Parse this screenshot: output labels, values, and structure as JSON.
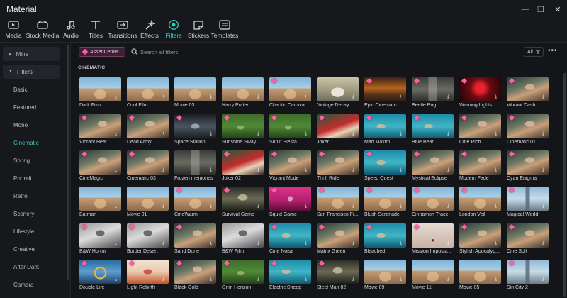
{
  "window": {
    "title": "Material",
    "minimize_icon": "—",
    "restore_icon": "❐",
    "close_icon": "✕"
  },
  "toolbar": {
    "items": [
      {
        "label": "Media",
        "icon": "media-icon"
      },
      {
        "label": "Stock Media",
        "icon": "stock-media-icon"
      },
      {
        "label": "Audio",
        "icon": "audio-icon"
      },
      {
        "label": "Titles",
        "icon": "titles-icon"
      },
      {
        "label": "Transitions",
        "icon": "transitions-icon"
      },
      {
        "label": "Effects",
        "icon": "effects-icon"
      },
      {
        "label": "Filters",
        "icon": "filters-icon",
        "active": true
      },
      {
        "label": "Stickers",
        "icon": "stickers-icon"
      },
      {
        "label": "Templates",
        "icon": "templates-icon"
      }
    ]
  },
  "sidebar": {
    "mine": "Mine",
    "filters": "Filters",
    "items": [
      "Basic",
      "Featured",
      "Mono",
      "Cinematic",
      "Spring",
      "Portrait",
      "Retro",
      "Scenery",
      "Lifestyle",
      "Creative",
      "After Dark",
      "Camera"
    ],
    "active": "Cinematic"
  },
  "content": {
    "asset_center": "Asset Center",
    "search_placeholder": "Search all filters",
    "filter_all": "All",
    "more_icon": "•••",
    "section_title": "CINEMATIC"
  },
  "filters": [
    {
      "name": "Dark Film",
      "scene": "town",
      "premium": false,
      "action": "download"
    },
    {
      "name": "Cool Film",
      "scene": "town",
      "premium": false,
      "action": "add"
    },
    {
      "name": "Movie 03",
      "scene": "town",
      "premium": false,
      "action": "download"
    },
    {
      "name": "Harry Potter",
      "scene": "town",
      "premium": false,
      "action": "download"
    },
    {
      "name": "Chaotic Carnival",
      "scene": "town",
      "premium": true,
      "action": "add"
    },
    {
      "name": "Vintage Decay",
      "scene": "car",
      "premium": false,
      "action": "download"
    },
    {
      "name": "Epic Cinematic",
      "scene": "sunset",
      "premium": true,
      "action": "add"
    },
    {
      "name": "Beetle Bug",
      "scene": "street",
      "premium": true,
      "action": "download"
    },
    {
      "name": "Warning Lights",
      "scene": "red",
      "premium": true,
      "action": "download"
    },
    {
      "name": "Vibrant Dash",
      "scene": "portrait",
      "premium": true,
      "action": "download"
    },
    {
      "name": "Vibrant Heat",
      "scene": "portrait",
      "premium": true,
      "action": "download"
    },
    {
      "name": "Dead Army",
      "scene": "portrait",
      "premium": true,
      "action": "add"
    },
    {
      "name": "Space Station",
      "scene": "space",
      "premium": true,
      "action": "download"
    },
    {
      "name": "Sunshine Sway",
      "scene": "forest",
      "premium": true,
      "action": "download"
    },
    {
      "name": "Sunlit Siesta",
      "scene": "forest",
      "premium": true,
      "action": "download"
    },
    {
      "name": "Joker",
      "scene": "joker",
      "premium": true,
      "action": "download"
    },
    {
      "name": "Mad Maxim",
      "scene": "water",
      "premium": true,
      "action": "download"
    },
    {
      "name": "Blue Bear",
      "scene": "water",
      "premium": true,
      "action": "download"
    },
    {
      "name": "Cine Rich",
      "scene": "portrait",
      "premium": true,
      "action": "download"
    },
    {
      "name": "Cinematic 01",
      "scene": "portrait",
      "premium": true,
      "action": "download"
    },
    {
      "name": "CineMagic",
      "scene": "portrait",
      "premium": true,
      "action": "download"
    },
    {
      "name": "Cinematic 03",
      "scene": "portrait",
      "premium": true,
      "action": "download"
    },
    {
      "name": "Frozen memories",
      "scene": "street",
      "premium": false,
      "action": "download"
    },
    {
      "name": "Joker 02",
      "scene": "joker",
      "premium": true,
      "action": "download"
    },
    {
      "name": "Vibrant Mode",
      "scene": "portrait",
      "premium": true,
      "action": "download"
    },
    {
      "name": "Thrill Ride",
      "scene": "portrait",
      "premium": true,
      "action": "download"
    },
    {
      "name": "Speed Quest",
      "scene": "water",
      "premium": true,
      "action": "download"
    },
    {
      "name": "Mystical Eclipse",
      "scene": "portrait",
      "premium": true,
      "action": "download"
    },
    {
      "name": "Modern Fade",
      "scene": "portrait",
      "premium": true,
      "action": "download"
    },
    {
      "name": "Cyan Enigma",
      "scene": "portrait",
      "premium": true,
      "action": "download"
    },
    {
      "name": "Batman",
      "scene": "town",
      "premium": false,
      "action": "download"
    },
    {
      "name": "Movie 01",
      "scene": "town",
      "premium": false,
      "action": "download"
    },
    {
      "name": "CineWarm",
      "scene": "town",
      "premium": true,
      "action": "download"
    },
    {
      "name": "Survival Game",
      "scene": "game",
      "premium": true,
      "action": "download"
    },
    {
      "name": "Squid Game",
      "scene": "squid",
      "premium": true,
      "action": "download"
    },
    {
      "name": "San Francisco Fr...",
      "scene": "town",
      "premium": true,
      "action": "download"
    },
    {
      "name": "Blush Serenade",
      "scene": "town",
      "premium": true,
      "action": "download"
    },
    {
      "name": "Cinnamon Trace",
      "scene": "town",
      "premium": true,
      "action": "download"
    },
    {
      "name": "London Veil",
      "scene": "town",
      "premium": true,
      "action": "download"
    },
    {
      "name": "Magical World",
      "scene": "castle",
      "premium": true,
      "action": "download"
    },
    {
      "name": "B&W Horror",
      "scene": "bw",
      "premium": true,
      "action": "download"
    },
    {
      "name": "Border Desert",
      "scene": "bw",
      "premium": true,
      "action": "download"
    },
    {
      "name": "Sand Dune",
      "scene": "portrait",
      "premium": true,
      "action": "download"
    },
    {
      "name": "B&W Film",
      "scene": "bw",
      "premium": false,
      "action": "download"
    },
    {
      "name": "Cine Noise",
      "scene": "water",
      "premium": true,
      "action": "download"
    },
    {
      "name": "Matrix Green",
      "scene": "portrait",
      "premium": true,
      "action": "download"
    },
    {
      "name": "Bleached",
      "scene": "water",
      "premium": true,
      "action": "download"
    },
    {
      "name": "Mission Impossi...",
      "scene": "sea",
      "premium": true,
      "action": "download"
    },
    {
      "name": "Stylish Apocalyp...",
      "scene": "portrait",
      "premium": true,
      "action": "download"
    },
    {
      "name": "Cine Soft",
      "scene": "portrait",
      "premium": true,
      "action": "download"
    },
    {
      "name": "Double Life",
      "scene": "ring",
      "premium": true,
      "action": "download"
    },
    {
      "name": "Light Rebirth",
      "scene": "fire",
      "premium": true,
      "action": "download"
    },
    {
      "name": "Black Gold",
      "scene": "portrait",
      "premium": true,
      "action": "download"
    },
    {
      "name": "Grim Horizon",
      "scene": "forest",
      "premium": true,
      "action": "download"
    },
    {
      "name": "Electric Sheep",
      "scene": "water",
      "premium": true,
      "action": "download"
    },
    {
      "name": "Steel Man 02",
      "scene": "game",
      "premium": true,
      "action": "download"
    },
    {
      "name": "Movie 09",
      "scene": "town",
      "premium": false,
      "action": "download"
    },
    {
      "name": "Movie 11",
      "scene": "town",
      "premium": false,
      "action": "download"
    },
    {
      "name": "Movie 05",
      "scene": "town",
      "premium": false,
      "action": "download"
    },
    {
      "name": "Sin City 2",
      "scene": "castle",
      "premium": true,
      "action": "download"
    }
  ],
  "colors": {
    "accent": "#2bd1c4",
    "premium": "#ff5fa2",
    "background": "#141519",
    "panel": "#17181c"
  }
}
